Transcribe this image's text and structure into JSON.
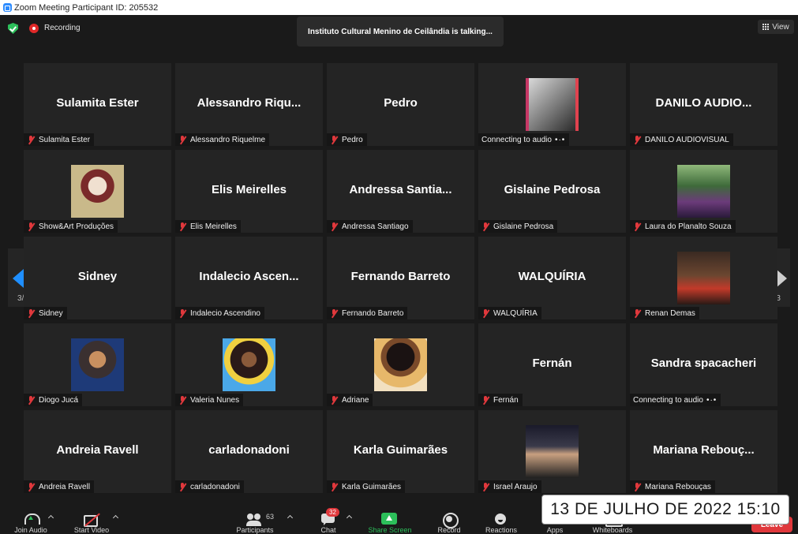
{
  "window": {
    "title": "Zoom Meeting Participant ID: 205532"
  },
  "status": {
    "recording_label": "Recording",
    "speaker_banner": "Instituto Cultural Menino de Ceilândia is talking...",
    "view_label": "View"
  },
  "pager": {
    "left_page": "3/3",
    "right_page": "3/3"
  },
  "tiles": [
    {
      "display_name": "Sulamita Ester",
      "label": "Sulamita Ester",
      "muted": true,
      "photo": null
    },
    {
      "display_name": "Alessandro  Riqu...",
      "label": "Alessandro Riquelme",
      "muted": true,
      "photo": null
    },
    {
      "display_name": "Pedro",
      "label": "Pedro",
      "muted": true,
      "photo": null
    },
    {
      "display_name": "",
      "label": "Connecting to audio",
      "muted": false,
      "connecting": true,
      "photo": "av-0"
    },
    {
      "display_name": "DANILO  AUDIO...",
      "label": "DANILO AUDIOVISUAL",
      "muted": true,
      "photo": null
    },
    {
      "display_name": "",
      "label": "Show&Art Produções",
      "muted": true,
      "photo": "av-1"
    },
    {
      "display_name": "Elis Meirelles",
      "label": "Elis Meirelles",
      "muted": true,
      "photo": null
    },
    {
      "display_name": "Andressa  Santia...",
      "label": "Andressa Santiago",
      "muted": true,
      "photo": null
    },
    {
      "display_name": "Gislaine Pedrosa",
      "label": "Gislaine Pedrosa",
      "muted": true,
      "photo": null
    },
    {
      "display_name": "",
      "label": "Laura do Planalto Souza",
      "muted": true,
      "photo": "av-2"
    },
    {
      "display_name": "Sidney",
      "label": "Sidney",
      "muted": true,
      "photo": null
    },
    {
      "display_name": "Indalecio  Ascen...",
      "label": "Indalecio Ascendino",
      "muted": true,
      "photo": null
    },
    {
      "display_name": "Fernando Barreto",
      "label": "Fernando Barreto",
      "muted": true,
      "photo": null
    },
    {
      "display_name": "WALQUÍRIA",
      "label": "WALQUÍRIA",
      "muted": true,
      "photo": null
    },
    {
      "display_name": "",
      "label": "Renan Demas",
      "muted": true,
      "photo": "av-3"
    },
    {
      "display_name": "",
      "label": "Diogo Jucá",
      "muted": true,
      "photo": "av-4"
    },
    {
      "display_name": "",
      "label": "Valeria Nunes",
      "muted": true,
      "photo": "av-5"
    },
    {
      "display_name": "",
      "label": "Adriane",
      "muted": true,
      "photo": "av-6"
    },
    {
      "display_name": "Fernán",
      "label": "Fernán",
      "muted": true,
      "photo": null
    },
    {
      "display_name": "Sandra spacacheri",
      "label": "Connecting to audio",
      "muted": false,
      "connecting": true,
      "photo": null
    },
    {
      "display_name": "Andreia Ravell",
      "label": "Andreia Ravell",
      "muted": true,
      "photo": null
    },
    {
      "display_name": "carladonadoni",
      "label": "carladonadoni",
      "muted": true,
      "photo": null
    },
    {
      "display_name": "Karla Guimarães",
      "label": "Karla Guimarães",
      "muted": true,
      "photo": null
    },
    {
      "display_name": "",
      "label": "Israel Araujo",
      "muted": true,
      "photo": "av-7"
    },
    {
      "display_name": "Mariana  Rebouç...",
      "label": "Mariana Rebouças",
      "muted": true,
      "photo": null
    }
  ],
  "toolbar": {
    "join_audio": "Join Audio",
    "start_video": "Start Video",
    "participants": "Participants",
    "participants_count": "63",
    "chat": "Chat",
    "chat_badge": "32",
    "share_screen": "Share Screen",
    "record": "Record",
    "reactions": "Reactions",
    "apps": "Apps",
    "whiteboards": "Whiteboards",
    "leave": "Leave"
  },
  "overlay": {
    "datestamp": "13 DE JULHO DE 2022 15:10"
  },
  "colors": {
    "accent": "#2d8cff",
    "muted_red": "#e0383c",
    "secure_green": "#2cbf5a",
    "tile_bg": "#242424"
  }
}
